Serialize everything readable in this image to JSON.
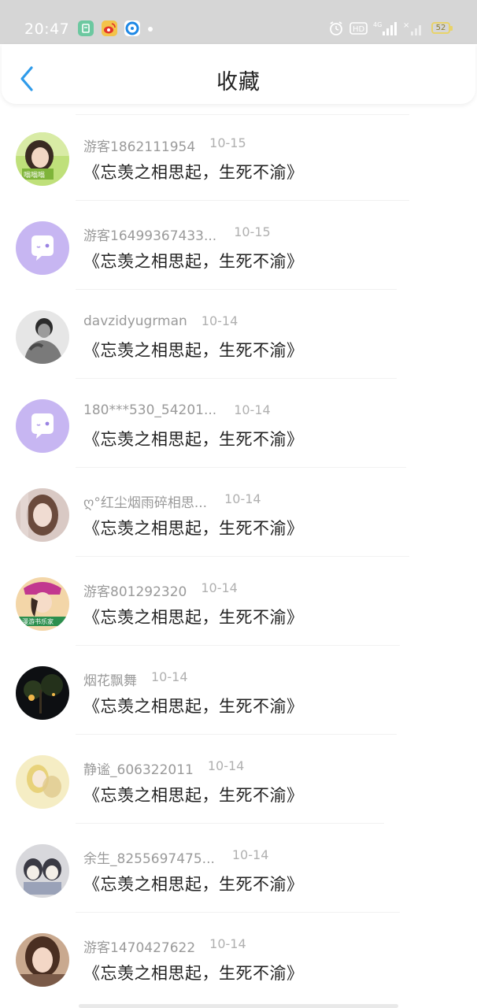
{
  "status_bar": {
    "time": "20:47",
    "battery": "52",
    "icons": [
      "app-green-icon",
      "weibo-icon",
      "browser-blue-icon",
      "alarm-icon",
      "hd-icon",
      "4g-signal-icon",
      "no-signal-icon",
      "battery-icon"
    ]
  },
  "header": {
    "title": "收藏",
    "back_icon": "chevron-left-icon",
    "accent": "#2f9bea"
  },
  "favorites": [
    {
      "user": "游客1862111954",
      "date": "10-15",
      "title": "《忘羡之相思起，生死不渝》",
      "avatar": "photo-avatar"
    },
    {
      "user": "游客16499367433...",
      "date": "10-15",
      "title": "《忘羡之相思起，生死不渝》",
      "avatar": "default-chat-avatar"
    },
    {
      "user": "davzidyugrman",
      "date": "10-14",
      "title": "《忘羡之相思起，生死不渝》",
      "avatar": "photo-avatar"
    },
    {
      "user": "180***530_54201...",
      "date": "10-14",
      "title": "《忘羡之相思起，生死不渝》",
      "avatar": "default-chat-avatar"
    },
    {
      "user": "ღ°红尘烟雨碎相思...",
      "date": "10-14",
      "title": "《忘羡之相思起，生死不渝》",
      "avatar": "photo-avatar"
    },
    {
      "user": "游客801292320",
      "date": "10-14",
      "title": "《忘羡之相思起，生死不渝》",
      "avatar": "photo-avatar"
    },
    {
      "user": "烟花飘舞",
      "date": "10-14",
      "title": "《忘羡之相思起，生死不渝》",
      "avatar": "photo-avatar"
    },
    {
      "user": "静谧_606322011",
      "date": "10-14",
      "title": "《忘羡之相思起，生死不渝》",
      "avatar": "photo-avatar"
    },
    {
      "user": "余生_8255697475...",
      "date": "10-14",
      "title": "《忘羡之相思起，生死不渝》",
      "avatar": "photo-avatar"
    },
    {
      "user": "游客1470427622",
      "date": "10-14",
      "title": "《忘羡之相思起，生死不渝》",
      "avatar": "photo-avatar"
    }
  ]
}
